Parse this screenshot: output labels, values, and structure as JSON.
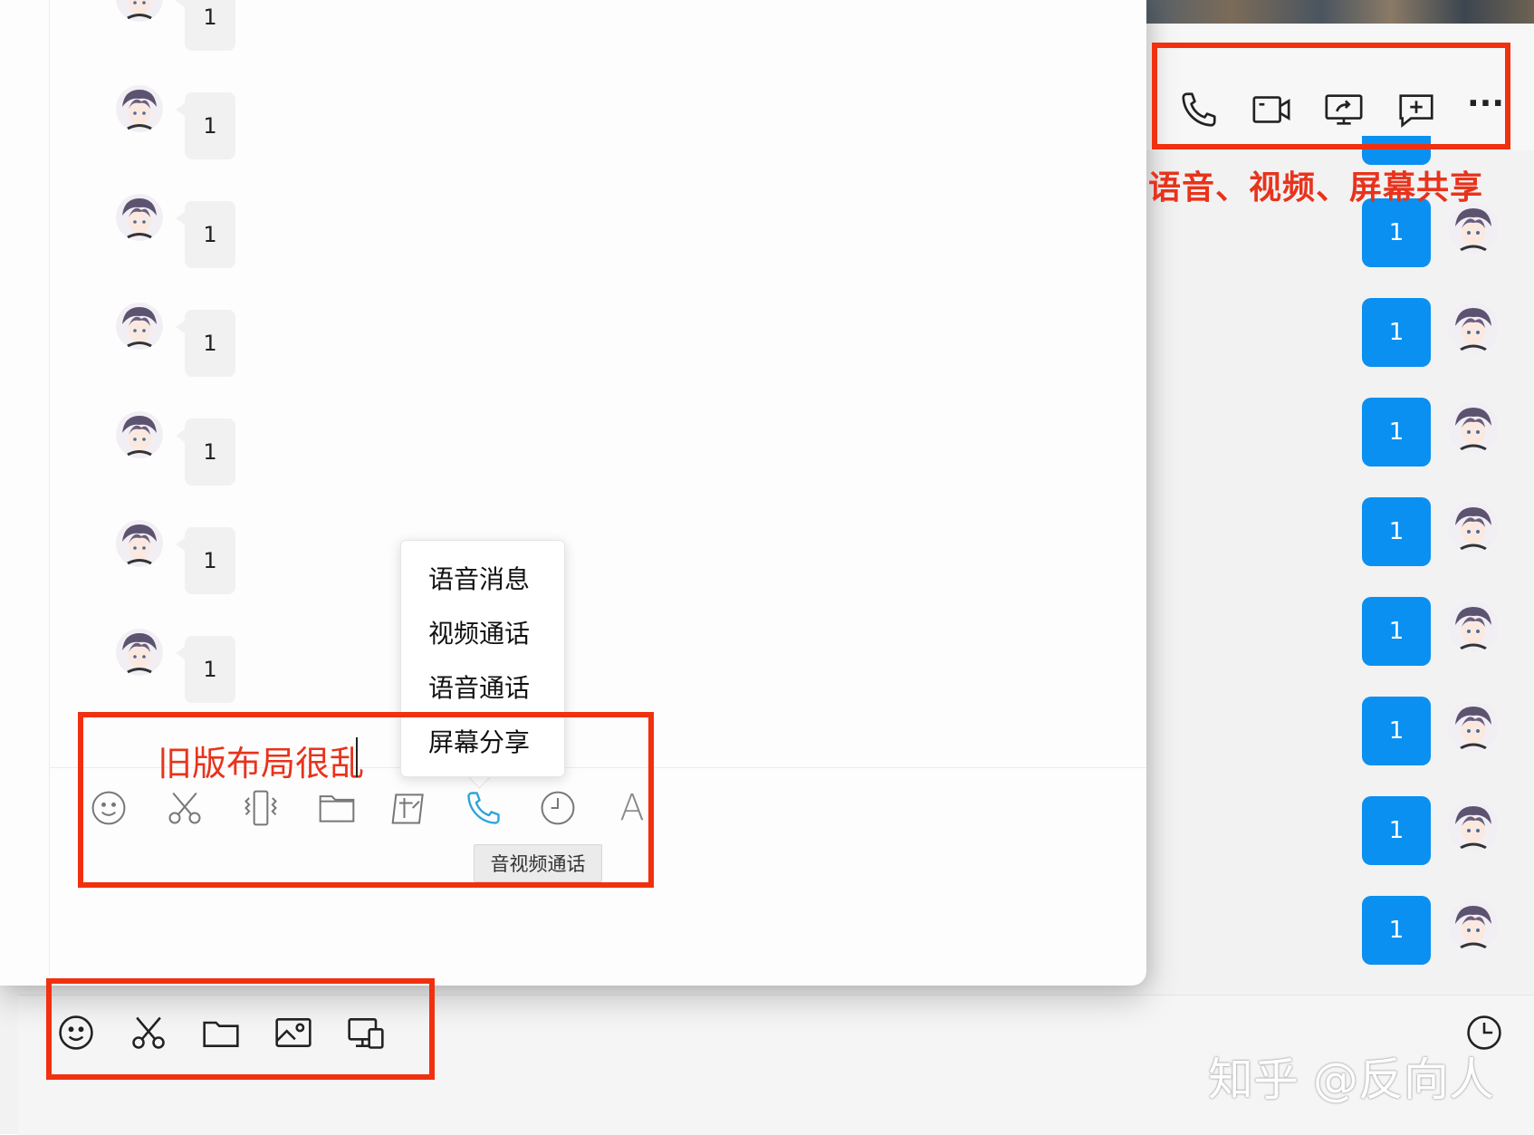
{
  "right_header": {
    "icons": [
      "phone-icon",
      "video-camera-icon",
      "screen-share-icon",
      "add-comment-icon",
      "more-icon"
    ],
    "more_label": "···"
  },
  "left_messages": [
    "1",
    "1",
    "1",
    "1",
    "1",
    "1",
    "1"
  ],
  "right_messages": [
    "1",
    "1",
    "1",
    "1",
    "1",
    "1",
    "1",
    "1"
  ],
  "input_text": "旧版布局很乱",
  "popup_menu": {
    "items": [
      "语音消息",
      "视频通话",
      "语音通话",
      "屏幕分享"
    ]
  },
  "tooltip": "音视频通话",
  "old_toolbar_icons": [
    "emoji-icon",
    "scissors-icon",
    "vibrate-icon",
    "folder-icon",
    "image-icon",
    "phone-icon",
    "clock-icon",
    "font-icon"
  ],
  "old_toolbar_font_glyph": "A",
  "new_toolbar_icons": [
    "emoji-icon",
    "scissors-icon",
    "folder-icon",
    "image-icon",
    "screen-icon"
  ],
  "history_icon": "clock-icon",
  "annotations": {
    "top_caption": "语音、视频、屏幕共享",
    "watermark": "知乎 @反向人"
  },
  "colors": {
    "annotation_red": "#f0300f",
    "message_blue": "#0a90f0",
    "active_icon": "#2ea4d8"
  }
}
